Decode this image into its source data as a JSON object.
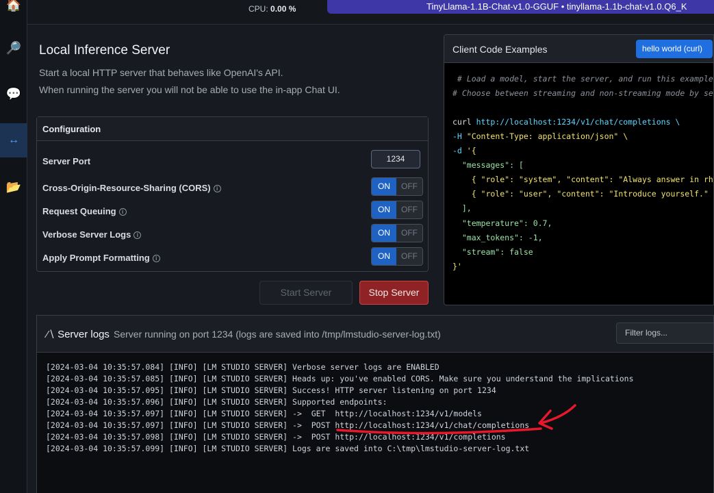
{
  "rail": {
    "items": [
      "home",
      "search",
      "chat",
      "server",
      "folder"
    ]
  },
  "topbar": {
    "cpu_label": "CPU:",
    "cpu_value": "0.00 %",
    "model": "TinyLlama-1.1B-Chat-v1.0-GGUF • tinyllama-1.1b-chat-v1.0.Q6_K"
  },
  "page": {
    "title": "Local Inference Server",
    "desc1": "Start a local HTTP server that behaves like OpenAI's API.",
    "desc2": "When running the server you will not be able to use the in-app Chat UI."
  },
  "config": {
    "title": "Configuration",
    "port_label": "Server Port",
    "port_value": "1234",
    "toggles": [
      {
        "label": "Cross-Origin-Resource-Sharing (CORS)",
        "on": "ON",
        "off": "OFF"
      },
      {
        "label": "Request Queuing",
        "on": "ON",
        "off": "OFF"
      },
      {
        "label": "Verbose Server Logs",
        "on": "ON",
        "off": "OFF"
      },
      {
        "label": "Apply Prompt Formatting",
        "on": "ON",
        "off": "OFF"
      }
    ],
    "info_glyph": "i"
  },
  "buttons": {
    "start": "Start Server",
    "stop": "Stop Server"
  },
  "code": {
    "title": "Client Code Examples",
    "tab": "hello world (curl)",
    "lines": {
      "c1": " # Load a model, start the server, and run this example",
      "c2": "# Choose between streaming and non-streaming mode by se",
      "curl_cmd": "curl",
      "curl_url": " http://localhost:1234/v1/chat/completions \\",
      "h_flag": "-H",
      "h_val": " \"Content-Type: application/json\" \\",
      "d_flag": "-d",
      "d_val": " '{",
      "messages": "  \"messages\": [",
      "sys": "    { \"role\": \"system\", \"content\": \"Always answer in rh",
      "user": "    { \"role\": \"user\", \"content\": \"Introduce yourself.\" ",
      "close_arr": "  ],",
      "temp": "  \"temperature\": 0.7,",
      "max": "  \"max_tokens\": -1,",
      "stream": "  \"stream\": false",
      "end": "}'"
    }
  },
  "logs": {
    "title": "Server logs",
    "status": "Server running on port 1234 (logs are saved into /tmp/lmstudio-server-log.txt)",
    "filter_placeholder": "Filter logs...",
    "entries": [
      "[2024-03-04 10:35:57.084] [INFO] [LM STUDIO SERVER] Verbose server logs are ENABLED",
      "[2024-03-04 10:35:57.085] [INFO] [LM STUDIO SERVER] Heads up: you've enabled CORS. Make sure you understand the implications",
      "[2024-03-04 10:35:57.095] [INFO] [LM STUDIO SERVER] Success! HTTP server listening on port 1234",
      "[2024-03-04 10:35:57.096] [INFO] [LM STUDIO SERVER] Supported endpoints:",
      "[2024-03-04 10:35:57.097] [INFO] [LM STUDIO SERVER] ->  GET  http://localhost:1234/v1/models",
      "[2024-03-04 10:35:57.097] [INFO] [LM STUDIO SERVER] ->  POST http://localhost:1234/v1/chat/completions",
      "[2024-03-04 10:35:57.098] [INFO] [LM STUDIO SERVER] ->  POST http://localhost:1234/v1/completions",
      "[2024-03-04 10:35:57.099] [INFO] [LM STUDIO SERVER] Logs are saved into C:\\tmp\\lmstudio-server-log.txt"
    ]
  },
  "colors": {
    "accent": "#1e62c4",
    "stop": "#8f2225",
    "annotation": "#e8182c"
  }
}
